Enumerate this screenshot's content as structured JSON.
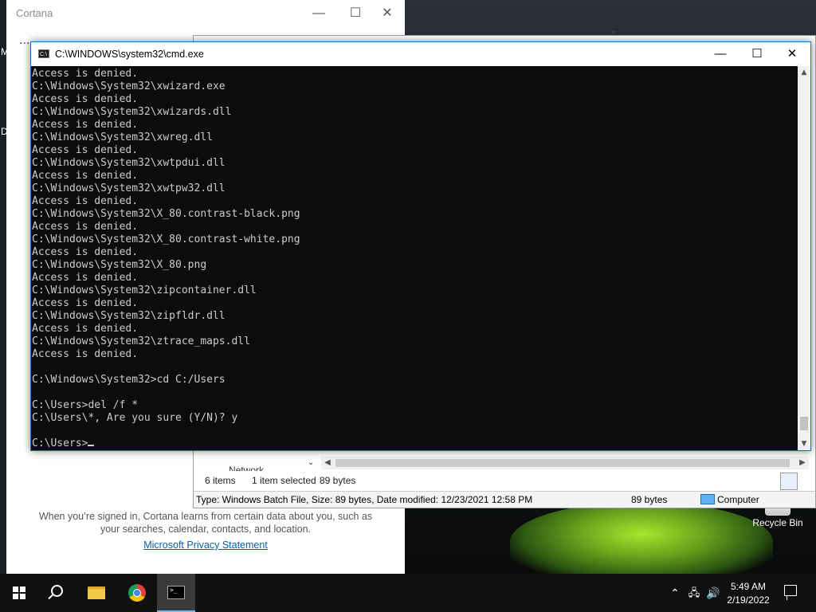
{
  "cortana": {
    "title": "Cortana",
    "dots": "...",
    "description": "When you’re signed in, Cortana learns from certain data about you, such as your searches, calendar, contacts, and location.",
    "privacy_link": "Microsoft Privacy Statement"
  },
  "cmd": {
    "title": "C:\\WINDOWS\\system32\\cmd.exe",
    "lines": [
      "Access is denied.",
      "C:\\Windows\\System32\\xwizard.exe",
      "Access is denied.",
      "C:\\Windows\\System32\\xwizards.dll",
      "Access is denied.",
      "C:\\Windows\\System32\\xwreg.dll",
      "Access is denied.",
      "C:\\Windows\\System32\\xwtpdui.dll",
      "Access is denied.",
      "C:\\Windows\\System32\\xwtpw32.dll",
      "Access is denied.",
      "C:\\Windows\\System32\\X_80.contrast-black.png",
      "Access is denied.",
      "C:\\Windows\\System32\\X_80.contrast-white.png",
      "Access is denied.",
      "C:\\Windows\\System32\\X_80.png",
      "Access is denied.",
      "C:\\Windows\\System32\\zipcontainer.dll",
      "Access is denied.",
      "C:\\Windows\\System32\\zipfldr.dll",
      "Access is denied.",
      "C:\\Windows\\System32\\ztrace_maps.dll",
      "Access is denied.",
      "",
      "C:\\Windows\\System32>cd C:/Users",
      "",
      "C:\\Users>del /f *",
      "C:\\Users\\*, Are you sure (Y/N)? y",
      ""
    ],
    "prompt": "C:\\Users>"
  },
  "explorer": {
    "nav_item": "Network",
    "status_items": "6 items",
    "status_selected": "1 item selected",
    "status_size": "89 bytes",
    "details_text": "Type: Windows Batch File, Size: 89 bytes, Date modified: 12/23/2021 12:58 PM",
    "details_size": "89 bytes",
    "details_location": "Computer"
  },
  "desktop": {
    "recycle_bin": "Recycle Bin",
    "side_letters": [
      "M",
      "D"
    ]
  },
  "taskbar": {
    "time": "5:49 AM",
    "date": "2/19/2022",
    "items": [
      "start-icon",
      "search-icon",
      "file-explorer-icon",
      "chrome-icon",
      "command-prompt-icon"
    ]
  }
}
